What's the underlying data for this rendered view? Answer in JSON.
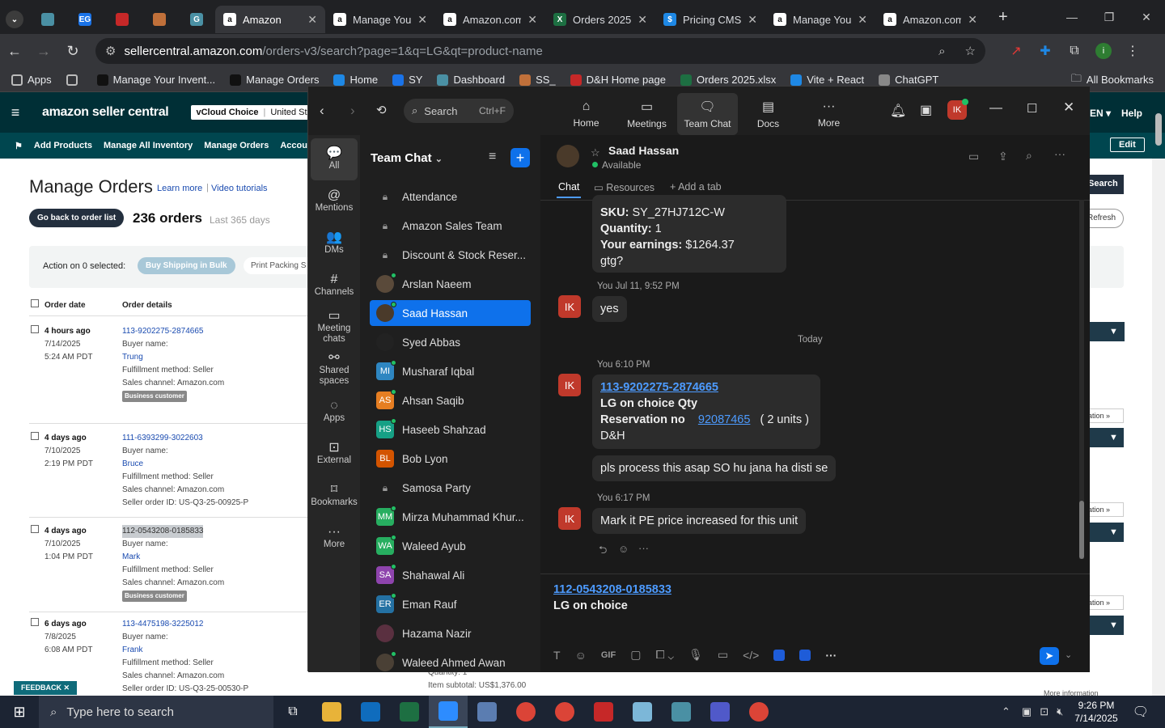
{
  "browser": {
    "tabs": [
      {
        "title": "",
        "icon": "dropdown",
        "color": "#555"
      },
      {
        "title": "",
        "icon": "hex",
        "color": "#4a90a4"
      },
      {
        "title": "",
        "icon": "EG",
        "color": "#1a73e8"
      },
      {
        "title": "",
        "icon": "red-box",
        "color": "#c62828"
      },
      {
        "title": "",
        "icon": "stack",
        "color": "#c0703a"
      },
      {
        "title": "",
        "icon": "G",
        "color": "#4a90a4"
      },
      {
        "title": "Amazon",
        "icon": "a",
        "color": "#111",
        "active": true
      },
      {
        "title": "Manage You",
        "icon": "a",
        "color": "#111"
      },
      {
        "title": "Amazon.com",
        "icon": "a",
        "color": "#111"
      },
      {
        "title": "Orders 2025",
        "icon": "X",
        "color": "#1d6f42"
      },
      {
        "title": "Pricing CMS",
        "icon": "$",
        "color": "#1e88e5"
      },
      {
        "title": "Manage You",
        "icon": "a",
        "color": "#111"
      },
      {
        "title": "Amazon.com",
        "icon": "a",
        "color": "#111"
      }
    ],
    "url_host": "sellercentral.amazon.com",
    "url_path": "/orders-v3/search?page=1&q=LG&qt=product-name",
    "bookmarks": [
      {
        "label": "Apps",
        "color": "#555"
      },
      {
        "label": "",
        "color": "#555"
      },
      {
        "label": "Manage Your Invent...",
        "color": "#111"
      },
      {
        "label": "Manage Orders",
        "color": "#111"
      },
      {
        "label": "Home",
        "color": "#1e88e5"
      },
      {
        "label": "SY",
        "color": "#1a73e8"
      },
      {
        "label": "Dashboard",
        "color": "#4a90a4"
      },
      {
        "label": "SS_",
        "color": "#c0703a"
      },
      {
        "label": "D&H Home page",
        "color": "#c62828"
      },
      {
        "label": "Orders 2025.xlsx",
        "color": "#1d6f42"
      },
      {
        "label": "Vite + React",
        "color": "#1e88e5"
      },
      {
        "label": "ChatGPT",
        "color": "#888"
      }
    ],
    "all_bookmarks": "All Bookmarks"
  },
  "amazon": {
    "logo": "amazon seller central",
    "store": "vCloud Choice",
    "country": "United States",
    "lang": "EN",
    "help": "Help",
    "subnav": [
      "Add Products",
      "Manage All Inventory",
      "Manage Orders",
      "Account H"
    ],
    "edit": "Edit",
    "title": "Manage Orders",
    "learn_more": "Learn more",
    "video_tutorials": "Video tutorials",
    "back_btn": "Go back to order list",
    "orders_count": "236 orders",
    "orders_range": "Last 365 days",
    "action_label": "Action on 0 selected:",
    "buy_shipping": "Buy Shipping in Bulk",
    "print_packing": "Print Packing S",
    "search_btn": "Search",
    "refresh_btn": "Refresh",
    "col_order_date": "Order date",
    "col_order_details": "Order details",
    "feedback": "FEEDBACK",
    "bottom_qty": "Quantity: 1",
    "bottom_subtotal": "Item subtotal: US$1,376.00",
    "more_info": "More information",
    "action_stub": "ation",
    "orders": [
      {
        "ago": "4 hours ago",
        "date": "7/14/2025",
        "time": "5:24 AM PDT",
        "id": "113-9202275-2874665",
        "buyer_label": "Buyer name:",
        "buyer": "Trung",
        "fulfill": "Fulfillment method: Seller",
        "channel": "Sales channel: Amazon.com",
        "extra": "",
        "badge": "Business customer"
      },
      {
        "ago": "4 days ago",
        "date": "7/10/2025",
        "time": "2:19 PM PDT",
        "id": "111-6393299-3022603",
        "buyer_label": "Buyer name:",
        "buyer": "Bruce",
        "fulfill": "Fulfillment method: Seller",
        "channel": "Sales channel: Amazon.com",
        "extra": "Seller order ID: US-Q3-25-00925-P",
        "badge": ""
      },
      {
        "ago": "4 days ago",
        "date": "7/10/2025",
        "time": "1:04 PM PDT",
        "id": "112-0543208-0185833",
        "buyer_label": "Buyer name:",
        "buyer": "Mark",
        "fulfill": "Fulfillment method: Seller",
        "channel": "Sales channel: Amazon.com",
        "extra": "",
        "badge": "Business customer"
      },
      {
        "ago": "6 days ago",
        "date": "7/8/2025",
        "time": "6:08 AM PDT",
        "id": "113-4475198-3225012",
        "buyer_label": "Buyer name:",
        "buyer": "Frank",
        "fulfill": "Fulfillment method: Seller",
        "channel": "Sales channel: Amazon.com",
        "extra": "Seller order ID: US-Q3-25-00530-P",
        "badge": ""
      }
    ]
  },
  "zoom": {
    "search_placeholder": "Search",
    "search_shortcut": "Ctrl+F",
    "nav": [
      {
        "label": "Home",
        "icon": "home-icon"
      },
      {
        "label": "Meetings",
        "icon": "video-icon"
      },
      {
        "label": "Team Chat",
        "icon": "chat-icon",
        "active": true
      },
      {
        "label": "Docs",
        "icon": "doc-icon"
      },
      {
        "label": "More",
        "icon": "more-icon"
      }
    ],
    "avatar_initials": "IK",
    "rail": [
      {
        "label": "All",
        "glyph": "💬",
        "active": true
      },
      {
        "label": "Mentions",
        "glyph": "@"
      },
      {
        "label": "DMs",
        "glyph": "👥"
      },
      {
        "label": "Channels",
        "glyph": "#"
      },
      {
        "label": "Meeting chats",
        "glyph": "▭"
      },
      {
        "label": "Shared spaces",
        "glyph": "⚯"
      },
      {
        "label": "Apps",
        "glyph": "◌"
      },
      {
        "label": "External",
        "glyph": "⊡"
      },
      {
        "label": "Bookmarks",
        "glyph": "⌑"
      },
      {
        "label": "More",
        "glyph": "···"
      }
    ],
    "list_title": "Team Chat",
    "channels": [
      {
        "name": "Attendance",
        "kind": "lock"
      },
      {
        "name": "Amazon Sales Team",
        "kind": "lock"
      },
      {
        "name": "Discount & Stock Reser...",
        "kind": "lock"
      },
      {
        "name": "Arslan Naeem",
        "kind": "photo",
        "color": "#5a4a3a",
        "online": true
      },
      {
        "name": "Saad Hassan",
        "kind": "photo",
        "color": "#4a3a2a",
        "online": true,
        "selected": true
      },
      {
        "name": "Syed Abbas",
        "kind": "photo",
        "color": "#222"
      },
      {
        "name": "Musharaf Iqbal",
        "kind": "initials",
        "initials": "MI",
        "color": "#2e86c1",
        "online": true
      },
      {
        "name": "Ahsan Saqib",
        "kind": "initials",
        "initials": "AS",
        "color": "#e67e22",
        "online": true
      },
      {
        "name": "Haseeb Shahzad",
        "kind": "initials",
        "initials": "HS",
        "color": "#16a085",
        "online": true
      },
      {
        "name": "Bob Lyon",
        "kind": "initials",
        "initials": "BL",
        "color": "#d35400"
      },
      {
        "name": "Samosa Party",
        "kind": "lock"
      },
      {
        "name": "Mirza Muhammad Khur...",
        "kind": "initials",
        "initials": "MM",
        "color": "#27ae60",
        "online": true
      },
      {
        "name": "Waleed Ayub",
        "kind": "initials",
        "initials": "WA",
        "color": "#27ae60",
        "online": true
      },
      {
        "name": "Shahawal Ali",
        "kind": "initials",
        "initials": "SA",
        "color": "#8e44ad",
        "online": true
      },
      {
        "name": "Eman Rauf",
        "kind": "initials",
        "initials": "ER",
        "color": "#2471a3",
        "online": true
      },
      {
        "name": "Hazama Nazir",
        "kind": "photo",
        "color": "#5a3040"
      },
      {
        "name": "Waleed Ahmed Awan",
        "kind": "photo",
        "color": "#4a4035",
        "online": true
      }
    ],
    "chat_name": "Saad Hassan",
    "chat_status": "Available",
    "tabs": [
      "Chat",
      "Resources",
      "Add a tab"
    ],
    "msg1_sku_label": "SKU:",
    "msg1_sku": "SY_27HJ712C-W",
    "msg1_qty_label": "Quantity:",
    "msg1_qty": "1",
    "msg1_earn_label": "Your earnings:",
    "msg1_earn": "$1264.37",
    "msg1_gtg": "gtg?",
    "msg2_meta": "You Jul 11, 9:52 PM",
    "msg2_text": "yes",
    "divider": "Today",
    "msg3_meta": "You 6:10 PM",
    "msg3_link": "113-9202275-2874665",
    "msg3_line2": "LG on choice Qty",
    "msg3_line3_label": "Reservation no",
    "msg3_res": "92087465",
    "msg3_units": "( 2 units )",
    "msg3_line4": "D&H",
    "msg4_text": "pls process this asap  SO hu jana ha disti se",
    "msg5_meta": "You 6:17 PM",
    "msg5_text": "Mark it PE price increased for this unit",
    "compose_link": "112-0543208-0185833",
    "compose_text": "LG on choice",
    "gif": "GIF"
  },
  "taskbar": {
    "search": "Type here to search",
    "time": "9:26 PM",
    "date": "7/14/2025",
    "apps": [
      {
        "color": "#e8b339"
      },
      {
        "color": "#0f6cbd"
      },
      {
        "color": "#1d6f42"
      },
      {
        "color": "#2d8cff",
        "active": true
      },
      {
        "color": "#5b7db1"
      },
      {
        "color": "#db4437"
      },
      {
        "color": "#db4437"
      },
      {
        "color": "#c62828"
      },
      {
        "color": "#7cb7d8"
      },
      {
        "color": "#4a90a4"
      },
      {
        "color": "#5059c9"
      },
      {
        "color": "#db4437"
      }
    ]
  }
}
